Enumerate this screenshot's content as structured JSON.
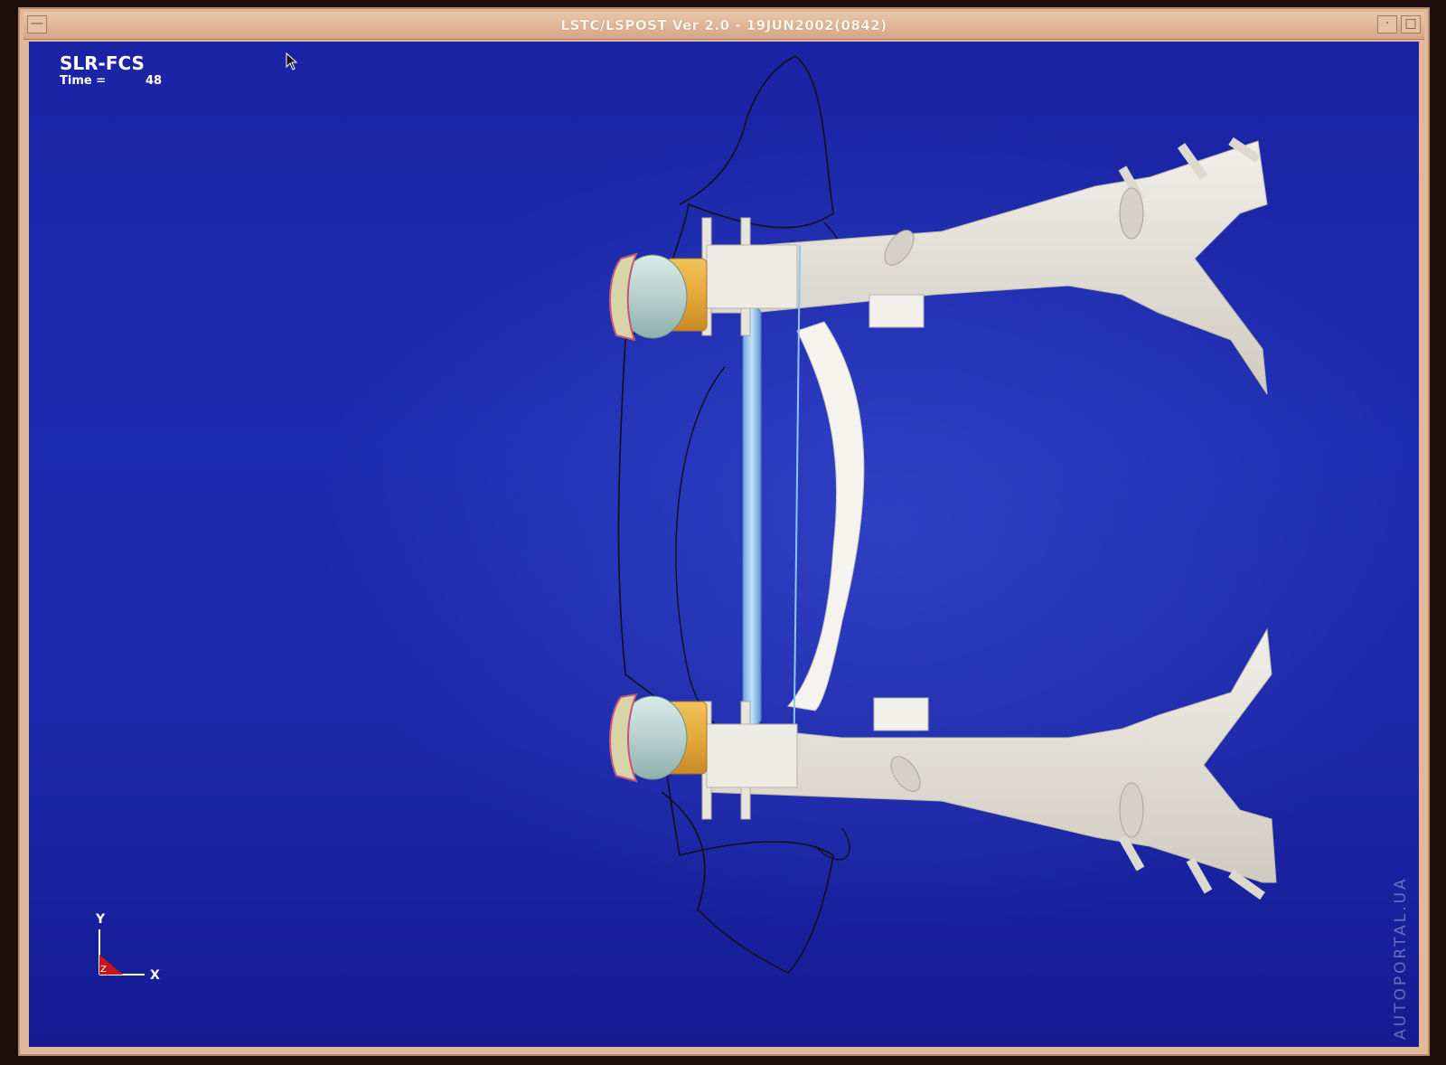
{
  "window": {
    "title": "LSTC/LSPOST Ver 2.0 - 19JUN2002(0842)",
    "menu_glyph": "—",
    "min_glyph": "·",
    "max_glyph": "□"
  },
  "viewport": {
    "model_name": "SLR-FCS",
    "time_label": "Time =",
    "time_value": "48"
  },
  "triad": {
    "y_label": "Y",
    "x_label": "X",
    "z_label": "Z"
  },
  "watermark": "AUTOPORTAL.UA",
  "colors": {
    "background": "#1d2bb0",
    "frame": "#e6e3da",
    "tire": "#e3a83c",
    "hub": "#b8d3d0",
    "bar": "#9cc8f0",
    "outline": "#101018",
    "titlebar": "#e2b89a"
  },
  "icons": [
    "menu-icon",
    "minimize-icon",
    "maximize-icon",
    "cursor-icon",
    "axis-triad-icon"
  ]
}
